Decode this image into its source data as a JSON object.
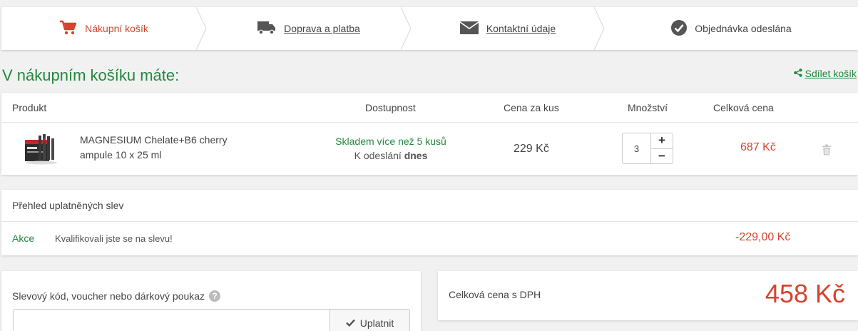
{
  "steps": [
    {
      "label": "Nákupní košík",
      "icon": "cart-icon",
      "state": "active"
    },
    {
      "label": "Doprava a platba",
      "icon": "truck-icon",
      "state": "link"
    },
    {
      "label": "Kontaktní údaje",
      "icon": "envelope-icon",
      "state": "link"
    },
    {
      "label": "Objednávka odeslána",
      "icon": "check-circle-icon",
      "state": "plain"
    }
  ],
  "heading": "V nákupním košíku máte:",
  "share_label": "Sdílet košík",
  "table": {
    "headers": {
      "product": "Produkt",
      "availability": "Dostupnost",
      "unit_price": "Cena za kus",
      "quantity": "Množství",
      "total": "Celková cena"
    },
    "items": [
      {
        "name": "MAGNESIUM Chelate+B6 cherry ampule 10 x 25 ml",
        "stock": "Skladem více než 5 kusů",
        "ship_prefix": "K odeslání",
        "ship_when": "dnes",
        "unit_price": "229 Kč",
        "quantity": "3",
        "plus": "+",
        "minus": "−",
        "total": "687 Kč"
      }
    ]
  },
  "discounts": {
    "title": "Přehled uplatněných slev",
    "rows": [
      {
        "type": "Akce",
        "message": "Kvalifikovali jste se na slevu!",
        "amount": "-229,00 Kč"
      }
    ]
  },
  "voucher": {
    "label": "Slevový kód, voucher nebo dárkový poukaz",
    "help": "?",
    "placeholder": "",
    "apply_label": "Uplatnit"
  },
  "summary": {
    "label": "Celková cena s DPH",
    "value": "458 Kč"
  },
  "colors": {
    "accent_green": "#24883f",
    "price_red": "#d6432f"
  }
}
